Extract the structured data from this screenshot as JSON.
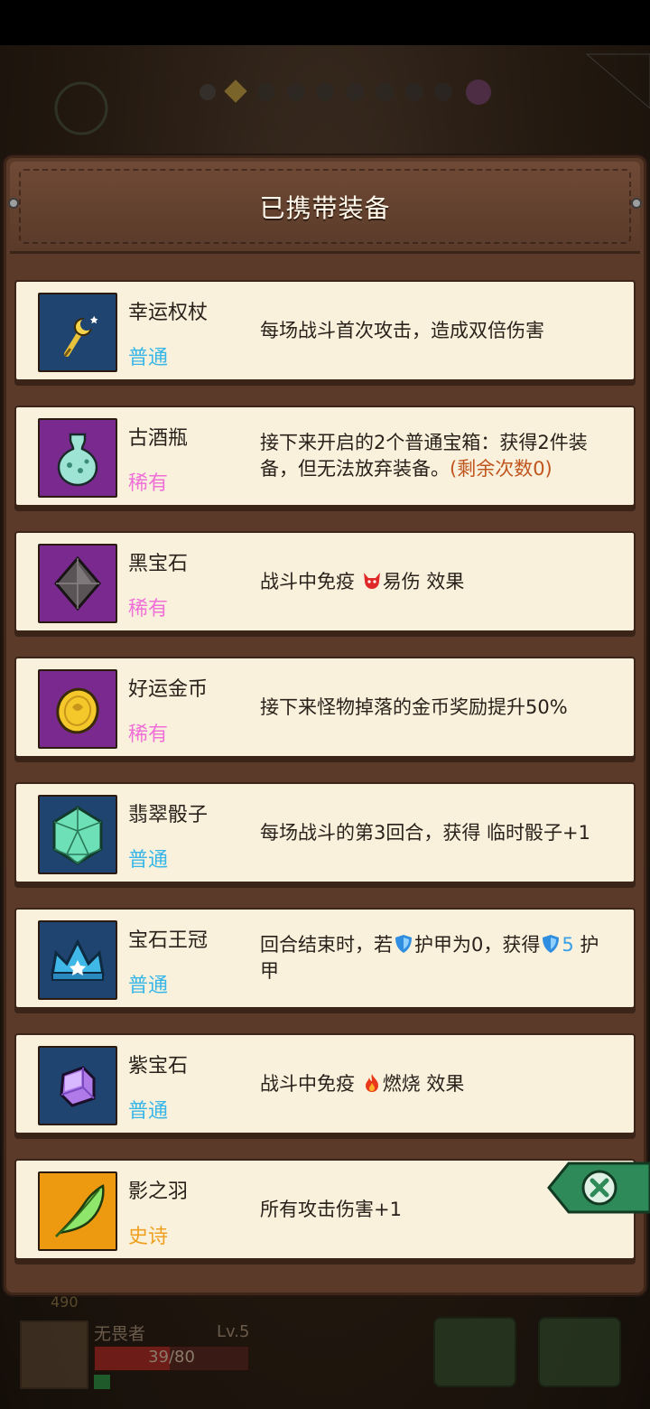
{
  "panel": {
    "title": "已携带装备"
  },
  "items": [
    {
      "name": "幸运权杖",
      "rarity": "普通",
      "desc": "每场战斗首次攻击，造成双倍伤害"
    },
    {
      "name": "古酒瓶",
      "rarity": "稀有",
      "desc": "接下来开启的2个普通宝箱：获得2件装备，但无法放弃装备。",
      "remaining": "(剩余次数0)"
    },
    {
      "name": "黑宝石",
      "rarity": "稀有",
      "desc_pre": "战斗中免疫 ",
      "effect": "易伤",
      "desc_post": " 效果"
    },
    {
      "name": "好运金币",
      "rarity": "稀有",
      "desc": "接下来怪物掉落的金币奖励提升50%"
    },
    {
      "name": "翡翠骰子",
      "rarity": "普通",
      "desc": "每场战斗的第3回合，获得 临时骰子+1"
    },
    {
      "name": "宝石王冠",
      "rarity": "普通",
      "desc_pre": "回合结束时，若",
      "desc_mid": "护甲为0，获得",
      "armor_value": "5",
      "desc_post": " 护甲"
    },
    {
      "name": "紫宝石",
      "rarity": "普通",
      "desc_pre": "战斗中免疫 ",
      "effect": "燃烧",
      "desc_post": " 效果"
    },
    {
      "name": "影之羽",
      "rarity": "史诗",
      "desc": "所有攻击伤害+1"
    }
  ],
  "hud": {
    "gold": "490",
    "hero_name": "无畏者",
    "level": "Lv.5",
    "hp": "39/80",
    "hp_fraction": 0.4875
  },
  "colors": {
    "rarity_common": "#38b6e8",
    "rarity_rare": "#f070d8",
    "rarity_epic": "#f0a020",
    "icon_bg_common": "#1f4470",
    "icon_bg_rare": "#7a2a8e",
    "icon_bg_epic": "#ee9a10"
  },
  "icons": [
    "scepter-icon",
    "vase-icon",
    "black-gem-icon",
    "gold-coin-icon",
    "emerald-dice-icon",
    "crown-icon",
    "purple-gem-icon",
    "feather-icon",
    "shield-icon",
    "fire-icon",
    "demon-icon",
    "close-icon"
  ]
}
